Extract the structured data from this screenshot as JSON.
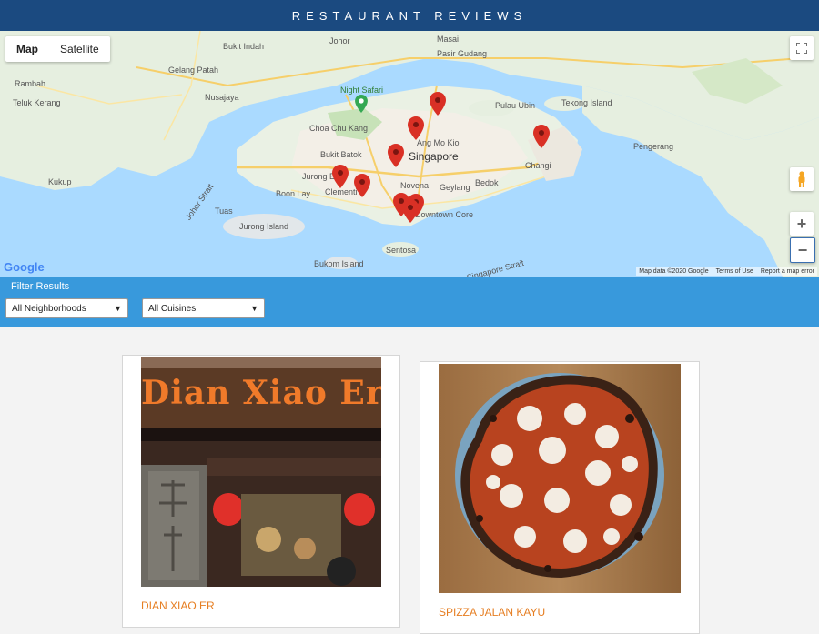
{
  "header": {
    "title": "RESTAURANT REVIEWS"
  },
  "map": {
    "type_control": {
      "map_label": "Map",
      "satellite_label": "Satellite",
      "selected": "Map"
    },
    "zoom": {
      "in_label": "+",
      "out_label": "−"
    },
    "fullscreen_icon": "fullscreen-icon",
    "pegman_icon": "pegman-icon",
    "logo": "Google",
    "attribution": [
      "Map data ©2020 Google",
      "Terms of Use",
      "Report a map error"
    ],
    "labels": [
      "Masai",
      "Pasir Gudang",
      "Johor",
      "Bukit Indah",
      "Gelang Patah",
      "Rambah",
      "Nusajaya",
      "Teluk Kerang",
      "Night Safari",
      "Pulau Ubin",
      "Tekong Island",
      "Singapore",
      "Pengerang",
      "Changi",
      "Kukup",
      "Jurong Island",
      "Sentosa",
      "Bukom Island",
      "Jurong East",
      "Clementi",
      "Boon Lay",
      "Tuas",
      "Novena",
      "Geylang",
      "Bedok",
      "Downtown Core",
      "Ang Mo Kio",
      "Bukit Batok",
      "Choa Chu Kang",
      "Johor Strait",
      "Singapore Strait"
    ]
  },
  "filter": {
    "title": "Filter Results",
    "neighborhoods": {
      "selected": "All Neighborhoods"
    },
    "cuisines": {
      "selected": "All Cuisines"
    }
  },
  "restaurants": [
    {
      "name": "DIAN XIAO ER",
      "sign": "Dian Xiao Er"
    },
    {
      "name": "SPIZZA JALAN KAYU"
    }
  ],
  "colors": {
    "header": "#1b4a80",
    "filter_bar": "#3899dc",
    "name": "#e67e22",
    "pin": "#d93025",
    "water": "#aadaff",
    "land": "#e8f0e3"
  }
}
